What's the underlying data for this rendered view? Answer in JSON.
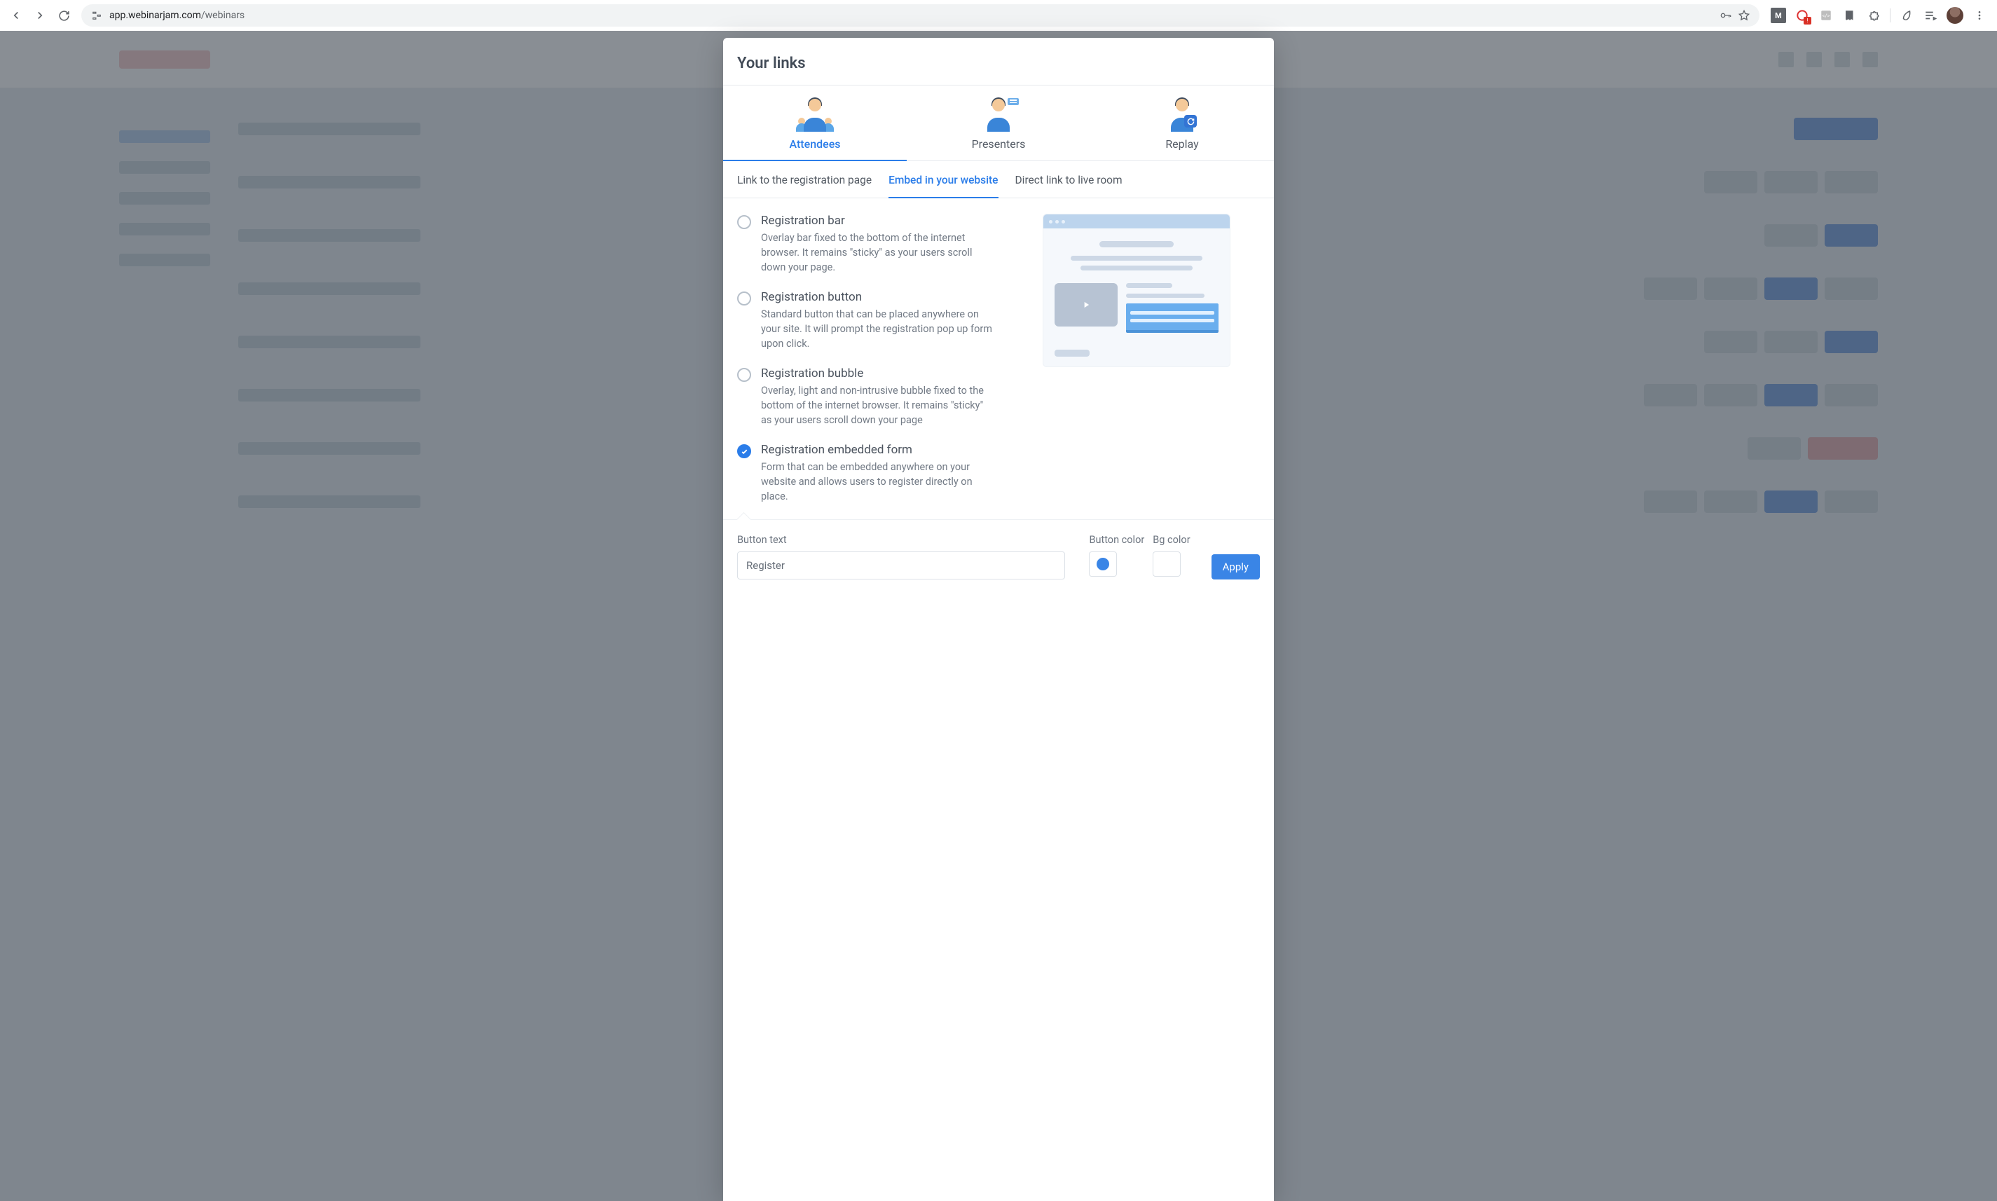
{
  "browser": {
    "url_host": "app.webinarjam.com",
    "url_path": "/webinars"
  },
  "modal": {
    "title": "Your links",
    "main_tabs": {
      "attendees": "Attendees",
      "presenters": "Presenters",
      "replay": "Replay"
    },
    "sub_tabs": {
      "link_reg": "Link to the registration page",
      "embed": "Embed in your website",
      "direct": "Direct link to live room"
    },
    "options": [
      {
        "title": "Registration bar",
        "desc": "Overlay bar fixed to the bottom of the internet browser. It remains \"sticky\" as your users scroll down your page."
      },
      {
        "title": "Registration button",
        "desc": "Standard button that can be placed anywhere on your site. It will prompt the registration pop up form upon click."
      },
      {
        "title": "Registration bubble",
        "desc": "Overlay, light and non-intrusive bubble fixed to the bottom of the internet browser. It remains \"sticky\" as your users scroll down your page"
      },
      {
        "title": "Registration embedded form",
        "desc": "Form that can be embedded anywhere on your website and allows users to register directly on place."
      }
    ],
    "footer": {
      "button_text_label": "Button text",
      "button_text_value": "Register",
      "button_color_label": "Button color",
      "bg_color_label": "Bg color",
      "apply_label": "Apply",
      "button_color": "#3a85e6",
      "bg_color": "#ffffff"
    }
  }
}
